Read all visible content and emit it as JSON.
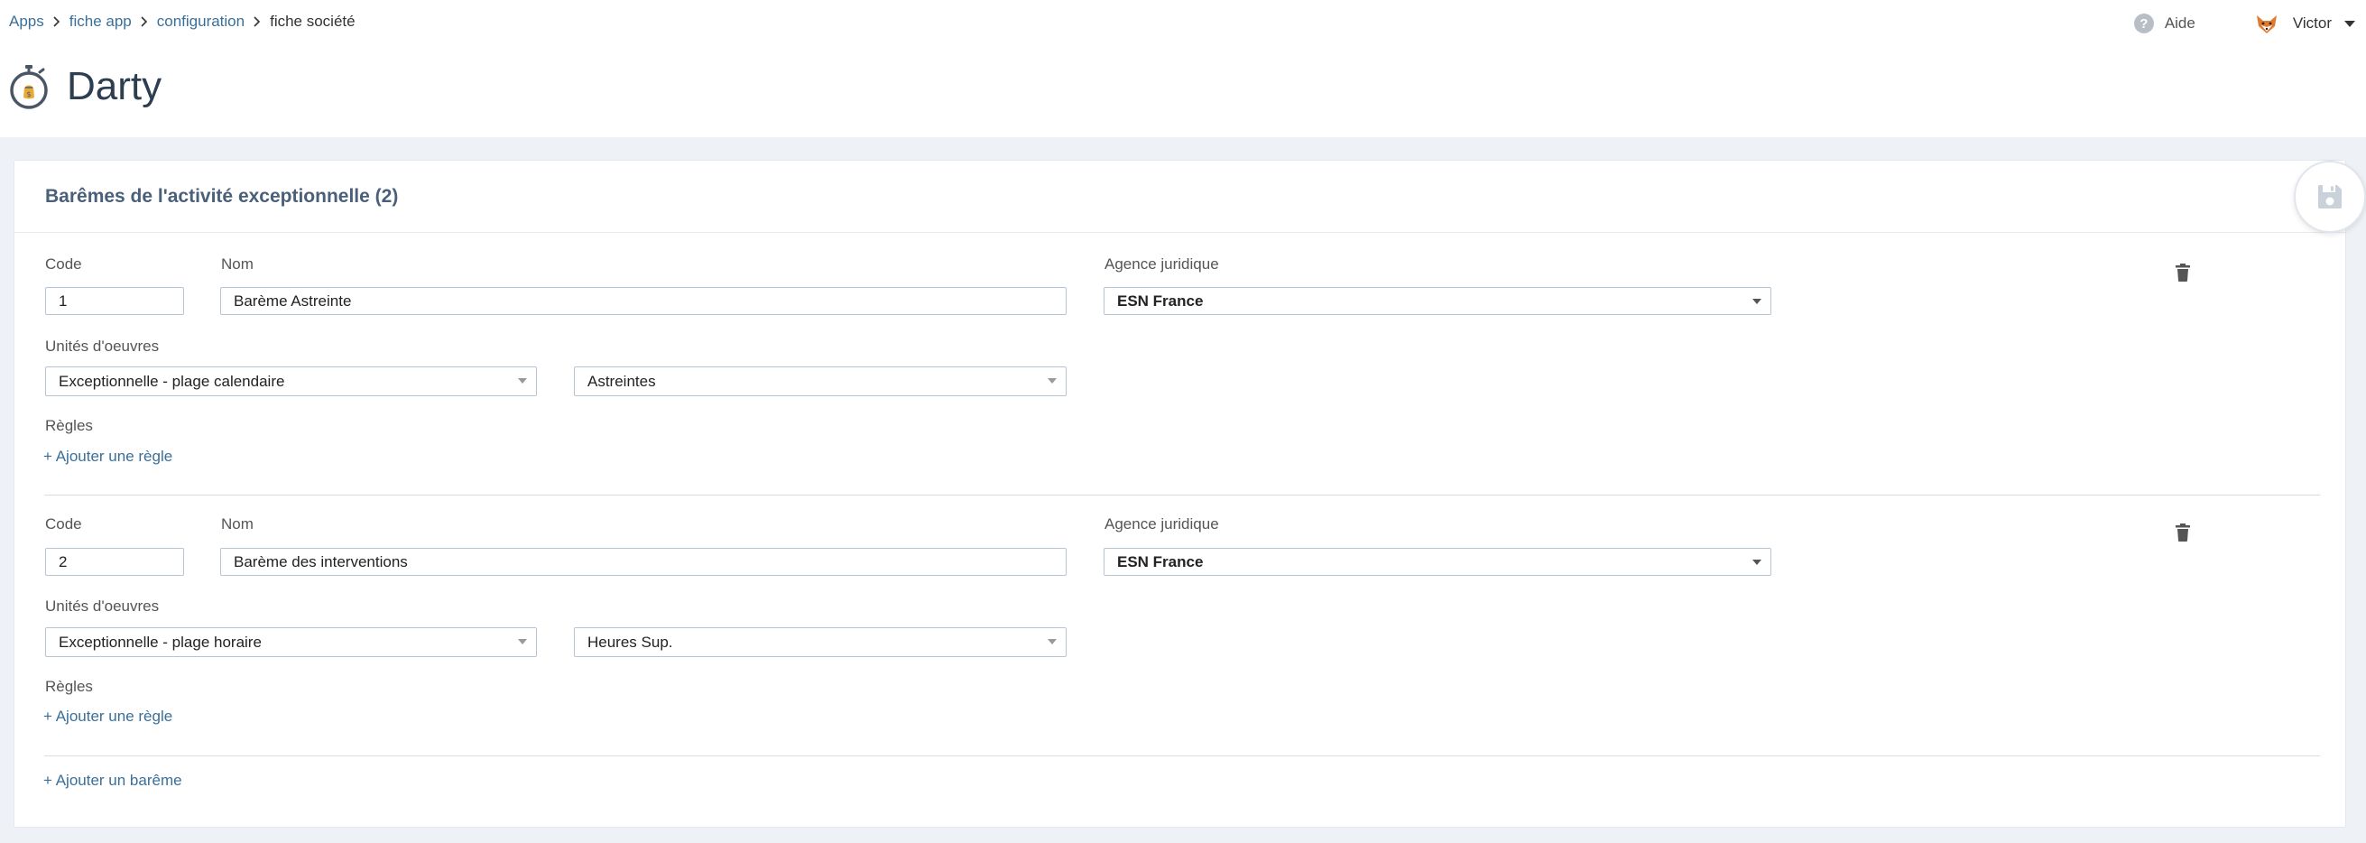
{
  "breadcrumb": [
    {
      "label": "Apps"
    },
    {
      "label": "fiche app"
    },
    {
      "label": "configuration"
    },
    {
      "label": "fiche société"
    }
  ],
  "topbar": {
    "help_label": "Aide",
    "user_name": "Victor"
  },
  "page": {
    "title": "Darty"
  },
  "card": {
    "title": "Barêmes de l'activité exceptionnelle (2)",
    "add_bareme_label": "+ Ajouter un barême"
  },
  "labels": {
    "code": "Code",
    "nom": "Nom",
    "agence": "Agence juridique",
    "unites": "Unités d'oeuvres",
    "regles": "Règles",
    "add_rule": "+ Ajouter une règle"
  },
  "baremes": [
    {
      "code": "1",
      "nom": "Barème Astreinte",
      "agence": "ESN France",
      "unite_type": "Exceptionnelle - plage calendaire",
      "unite": "Astreintes"
    },
    {
      "code": "2",
      "nom": "Barème des interventions",
      "agence": "ESN France",
      "unite_type": "Exceptionnelle - plage horaire",
      "unite": "Heures Sup."
    }
  ],
  "icons": {
    "app": "timer-money-icon",
    "help": "question-circle-icon",
    "avatar": "fox-avatar-icon",
    "save": "floppy-disk-icon",
    "delete": "trash-icon",
    "breadcrumb_separator": "chevron-right-icon"
  },
  "colors": {
    "link": "#3a6f99",
    "title": "#4a5f7a",
    "background": "#eef2f7"
  }
}
